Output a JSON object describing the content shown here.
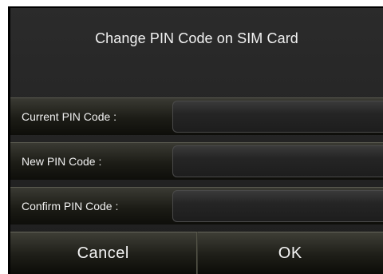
{
  "dialog": {
    "title": "Change PIN Code on SIM Card"
  },
  "fields": [
    {
      "label": "Current PIN Code :",
      "value": "",
      "placeholder": ""
    },
    {
      "label": "New PIN Code :",
      "value": "",
      "placeholder": ""
    },
    {
      "label": "Confirm PIN Code :",
      "value": "",
      "placeholder": ""
    }
  ],
  "buttons": {
    "cancel_label": "Cancel",
    "ok_label": "OK"
  }
}
